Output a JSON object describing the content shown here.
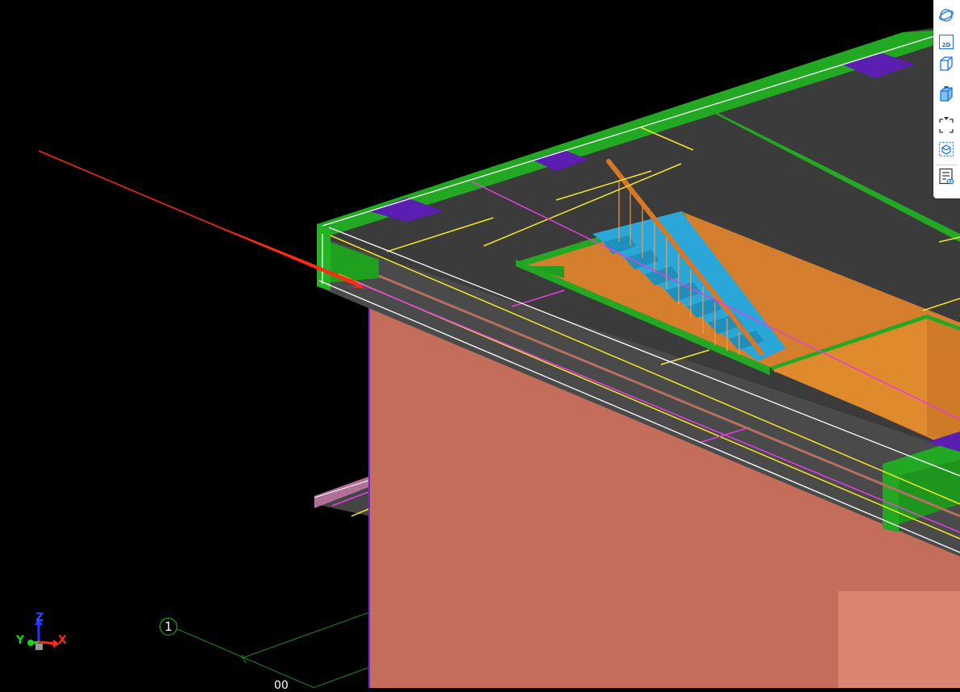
{
  "toolbar": {
    "buttons": [
      {
        "name": "orbit-view",
        "icon": "sphere-orbit-icon"
      },
      {
        "name": "2d-view",
        "icon": "2d-view-icon",
        "label": "2D"
      },
      {
        "name": "3d-box-view",
        "icon": "box-outline-icon"
      },
      {
        "name": "3d-shaded-view",
        "icon": "box-shaded-icon"
      },
      {
        "name": "zoom-extents",
        "icon": "dashed-frame-icon"
      },
      {
        "name": "dynamic-observe",
        "icon": "dashed-cube-icon"
      },
      {
        "name": "view-list",
        "icon": "list-eye-icon"
      }
    ],
    "accent": "#1a73d9"
  },
  "scene": {
    "grid_label": "1",
    "grid_dimension": "00",
    "axes": {
      "x": "X",
      "y": "Y",
      "z": "Z"
    }
  },
  "colors": {
    "background": "#000000",
    "wall": "#c36d5a",
    "slab_top": "#3b3b3b",
    "beam": "#22a822",
    "stair": "#2aa7d8",
    "pit_floor": "#d57e2e",
    "column_cap": "#5a1fb0",
    "rebar_yellow": "#f2e629",
    "rebar_magenta": "#e23fe0",
    "arrow": "#ff2a16"
  }
}
